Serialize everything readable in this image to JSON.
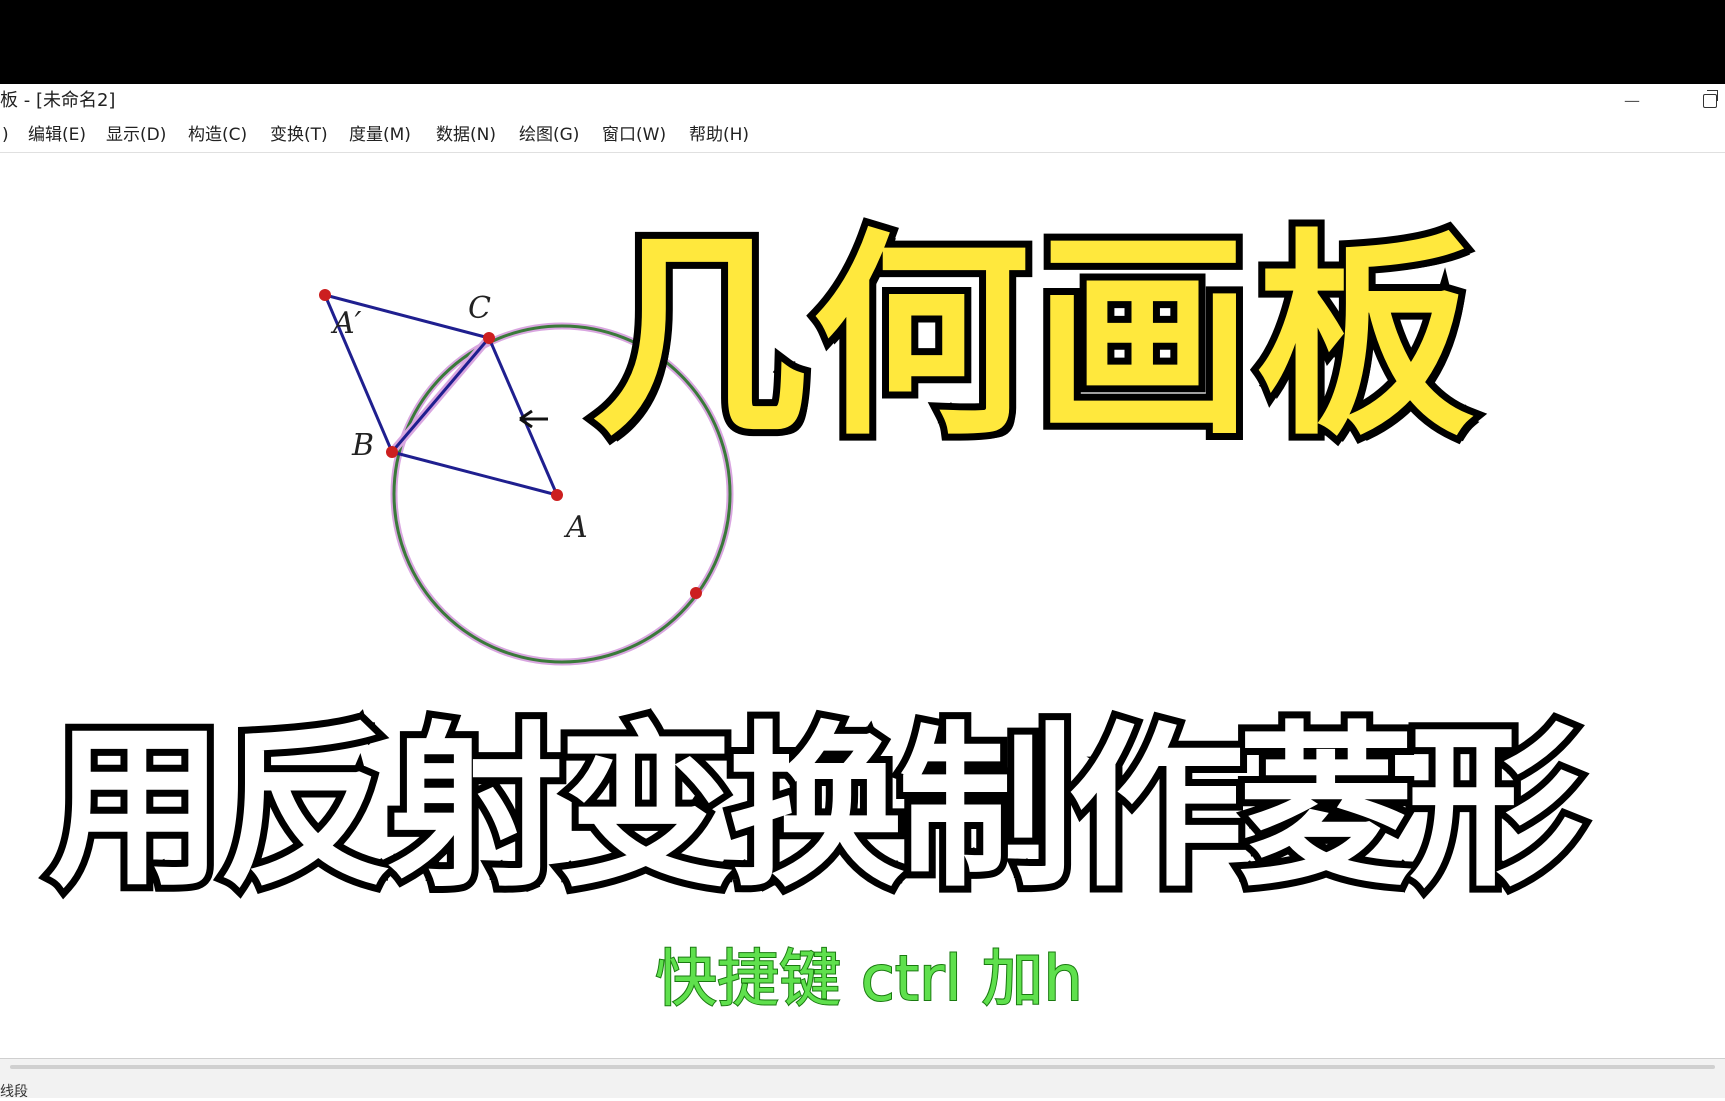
{
  "window": {
    "title": "板 - [未命名2]",
    "minimize_glyph": "—"
  },
  "menu": [
    {
      "label": ")"
    },
    {
      "label": "编辑(E)"
    },
    {
      "label": "显示(D)"
    },
    {
      "label": "构造(C)"
    },
    {
      "label": "变换(T)"
    },
    {
      "label": "度量(M)"
    },
    {
      "label": "数据(N)"
    },
    {
      "label": "绘图(G)"
    },
    {
      "label": "窗口(W)"
    },
    {
      "label": "帮助(H)"
    }
  ],
  "sketch": {
    "points": {
      "a_prime": "A′",
      "c": "C",
      "b": "B",
      "a": "A"
    },
    "colors": {
      "segment": "#1f1f8f",
      "circle": "#3a7a3a",
      "circle_halo": "#d9a6e0",
      "point": "#cc1f1f"
    }
  },
  "overlay": {
    "title": "几何画板",
    "subtitle": "用反射变换制作菱形",
    "hint": "快捷键 ctrl 加h",
    "colors": {
      "title_fill": "#ffe83d",
      "subtitle_fill": "#ffffff",
      "hint_fill": "#5fe04d",
      "outline": "#000000"
    }
  },
  "status": {
    "text": "线段"
  }
}
